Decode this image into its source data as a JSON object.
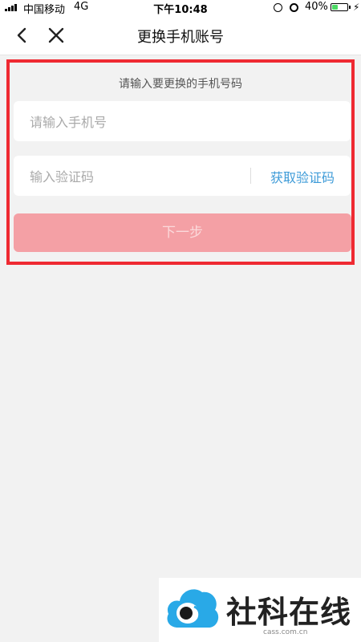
{
  "status_bar": {
    "carrier": "中国移动",
    "network": "4G",
    "time": "下午10:48",
    "battery": "40%",
    "battery_level": 0.4,
    "battery_color": "#4cd964"
  },
  "nav": {
    "back_icon": "chevron-left-icon",
    "close_icon": "close-icon",
    "title": "更换手机账号"
  },
  "form": {
    "hint": "请输入要更换的手机号码",
    "phone_placeholder": "请输入手机号",
    "phone_value": "",
    "code_placeholder": "输入验证码",
    "code_value": "",
    "get_code_label": "获取验证码",
    "next_label": "下一步"
  },
  "colors": {
    "highlight": "#ef2a32",
    "link": "#3e9bd8",
    "button_disabled": "#f4a0a5"
  },
  "watermark": {
    "title": "社科在线",
    "url": "cass.com.cn"
  }
}
